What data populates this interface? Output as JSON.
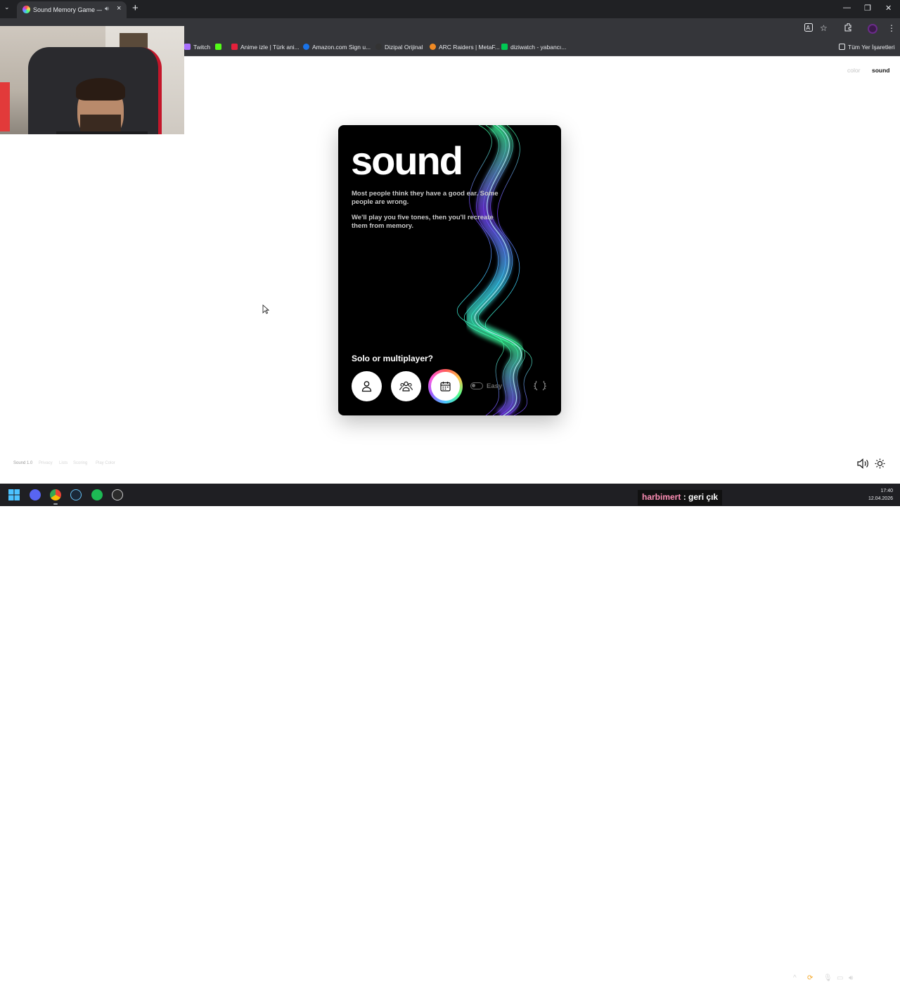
{
  "browser": {
    "tab_title": "Sound Memory Game — H",
    "bookmarks": [
      {
        "label": "Twitch",
        "color": "#a970ff"
      },
      {
        "label": "",
        "color": "#53fc18"
      },
      {
        "label": "Anime izle | Türk ani...",
        "color": "#e4203b"
      },
      {
        "label": "Amazon.com Sign u...",
        "color": "#1a73e8"
      },
      {
        "label": "Dizipal Orijinal",
        "color": "#333333"
      },
      {
        "label": "ARC Raiders | MetaF...",
        "color": "#f08a24"
      },
      {
        "label": "diziwatch - yabancı...",
        "color": "#00c853"
      }
    ],
    "all_bookmarks": "Tüm Yer İşaretleri"
  },
  "nav": {
    "color": "color",
    "sound": "sound"
  },
  "card": {
    "title": "sound",
    "p1": "Most people think they have a good ear. Some people are wrong.",
    "p2": "We'll play you five tones, then you'll recreate them from memory.",
    "question": "Solo or multiplayer?",
    "mode_toggle_label": "Easy"
  },
  "footer": {
    "items": [
      "Sound 1.0",
      "Privacy",
      "Lists",
      "Scoring",
      "Play Color"
    ]
  },
  "taskbar": {
    "chat_user": "harbimert",
    "chat_sep": ":",
    "chat_message": "geri çık",
    "time": "17:40",
    "date": "12.04.2026"
  },
  "colors": {
    "card_bg": "#000000",
    "wave_green": "#3cff9c",
    "wave_purple": "#7b3cff",
    "wave_cyan": "#3cd8ff"
  }
}
